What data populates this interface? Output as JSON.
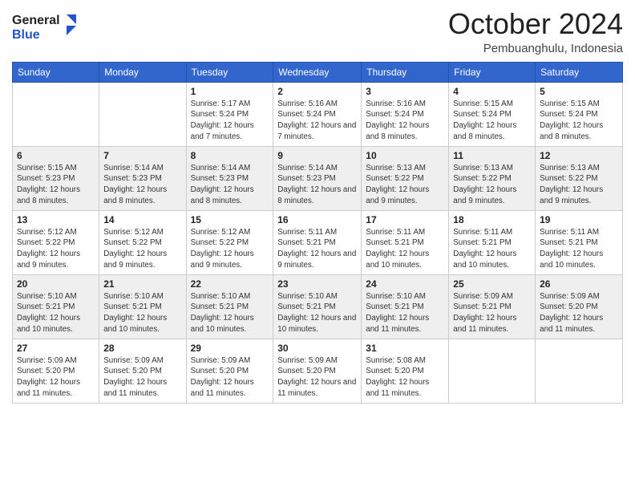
{
  "logo": {
    "line1": "General",
    "line2": "Blue",
    "icon_color": "#2255aa"
  },
  "header": {
    "month": "October 2024",
    "location": "Pembuanghulu, Indonesia"
  },
  "weekdays": [
    "Sunday",
    "Monday",
    "Tuesday",
    "Wednesday",
    "Thursday",
    "Friday",
    "Saturday"
  ],
  "weeks": [
    [
      {
        "day": "",
        "sunrise": "",
        "sunset": "",
        "daylight": ""
      },
      {
        "day": "",
        "sunrise": "",
        "sunset": "",
        "daylight": ""
      },
      {
        "day": "1",
        "sunrise": "Sunrise: 5:17 AM",
        "sunset": "Sunset: 5:24 PM",
        "daylight": "Daylight: 12 hours and 7 minutes."
      },
      {
        "day": "2",
        "sunrise": "Sunrise: 5:16 AM",
        "sunset": "Sunset: 5:24 PM",
        "daylight": "Daylight: 12 hours and 7 minutes."
      },
      {
        "day": "3",
        "sunrise": "Sunrise: 5:16 AM",
        "sunset": "Sunset: 5:24 PM",
        "daylight": "Daylight: 12 hours and 8 minutes."
      },
      {
        "day": "4",
        "sunrise": "Sunrise: 5:15 AM",
        "sunset": "Sunset: 5:24 PM",
        "daylight": "Daylight: 12 hours and 8 minutes."
      },
      {
        "day": "5",
        "sunrise": "Sunrise: 5:15 AM",
        "sunset": "Sunset: 5:24 PM",
        "daylight": "Daylight: 12 hours and 8 minutes."
      }
    ],
    [
      {
        "day": "6",
        "sunrise": "Sunrise: 5:15 AM",
        "sunset": "Sunset: 5:23 PM",
        "daylight": "Daylight: 12 hours and 8 minutes."
      },
      {
        "day": "7",
        "sunrise": "Sunrise: 5:14 AM",
        "sunset": "Sunset: 5:23 PM",
        "daylight": "Daylight: 12 hours and 8 minutes."
      },
      {
        "day": "8",
        "sunrise": "Sunrise: 5:14 AM",
        "sunset": "Sunset: 5:23 PM",
        "daylight": "Daylight: 12 hours and 8 minutes."
      },
      {
        "day": "9",
        "sunrise": "Sunrise: 5:14 AM",
        "sunset": "Sunset: 5:23 PM",
        "daylight": "Daylight: 12 hours and 8 minutes."
      },
      {
        "day": "10",
        "sunrise": "Sunrise: 5:13 AM",
        "sunset": "Sunset: 5:22 PM",
        "daylight": "Daylight: 12 hours and 9 minutes."
      },
      {
        "day": "11",
        "sunrise": "Sunrise: 5:13 AM",
        "sunset": "Sunset: 5:22 PM",
        "daylight": "Daylight: 12 hours and 9 minutes."
      },
      {
        "day": "12",
        "sunrise": "Sunrise: 5:13 AM",
        "sunset": "Sunset: 5:22 PM",
        "daylight": "Daylight: 12 hours and 9 minutes."
      }
    ],
    [
      {
        "day": "13",
        "sunrise": "Sunrise: 5:12 AM",
        "sunset": "Sunset: 5:22 PM",
        "daylight": "Daylight: 12 hours and 9 minutes."
      },
      {
        "day": "14",
        "sunrise": "Sunrise: 5:12 AM",
        "sunset": "Sunset: 5:22 PM",
        "daylight": "Daylight: 12 hours and 9 minutes."
      },
      {
        "day": "15",
        "sunrise": "Sunrise: 5:12 AM",
        "sunset": "Sunset: 5:22 PM",
        "daylight": "Daylight: 12 hours and 9 minutes."
      },
      {
        "day": "16",
        "sunrise": "Sunrise: 5:11 AM",
        "sunset": "Sunset: 5:21 PM",
        "daylight": "Daylight: 12 hours and 9 minutes."
      },
      {
        "day": "17",
        "sunrise": "Sunrise: 5:11 AM",
        "sunset": "Sunset: 5:21 PM",
        "daylight": "Daylight: 12 hours and 10 minutes."
      },
      {
        "day": "18",
        "sunrise": "Sunrise: 5:11 AM",
        "sunset": "Sunset: 5:21 PM",
        "daylight": "Daylight: 12 hours and 10 minutes."
      },
      {
        "day": "19",
        "sunrise": "Sunrise: 5:11 AM",
        "sunset": "Sunset: 5:21 PM",
        "daylight": "Daylight: 12 hours and 10 minutes."
      }
    ],
    [
      {
        "day": "20",
        "sunrise": "Sunrise: 5:10 AM",
        "sunset": "Sunset: 5:21 PM",
        "daylight": "Daylight: 12 hours and 10 minutes."
      },
      {
        "day": "21",
        "sunrise": "Sunrise: 5:10 AM",
        "sunset": "Sunset: 5:21 PM",
        "daylight": "Daylight: 12 hours and 10 minutes."
      },
      {
        "day": "22",
        "sunrise": "Sunrise: 5:10 AM",
        "sunset": "Sunset: 5:21 PM",
        "daylight": "Daylight: 12 hours and 10 minutes."
      },
      {
        "day": "23",
        "sunrise": "Sunrise: 5:10 AM",
        "sunset": "Sunset: 5:21 PM",
        "daylight": "Daylight: 12 hours and 10 minutes."
      },
      {
        "day": "24",
        "sunrise": "Sunrise: 5:10 AM",
        "sunset": "Sunset: 5:21 PM",
        "daylight": "Daylight: 12 hours and 11 minutes."
      },
      {
        "day": "25",
        "sunrise": "Sunrise: 5:09 AM",
        "sunset": "Sunset: 5:21 PM",
        "daylight": "Daylight: 12 hours and 11 minutes."
      },
      {
        "day": "26",
        "sunrise": "Sunrise: 5:09 AM",
        "sunset": "Sunset: 5:20 PM",
        "daylight": "Daylight: 12 hours and 11 minutes."
      }
    ],
    [
      {
        "day": "27",
        "sunrise": "Sunrise: 5:09 AM",
        "sunset": "Sunset: 5:20 PM",
        "daylight": "Daylight: 12 hours and 11 minutes."
      },
      {
        "day": "28",
        "sunrise": "Sunrise: 5:09 AM",
        "sunset": "Sunset: 5:20 PM",
        "daylight": "Daylight: 12 hours and 11 minutes."
      },
      {
        "day": "29",
        "sunrise": "Sunrise: 5:09 AM",
        "sunset": "Sunset: 5:20 PM",
        "daylight": "Daylight: 12 hours and 11 minutes."
      },
      {
        "day": "30",
        "sunrise": "Sunrise: 5:09 AM",
        "sunset": "Sunset: 5:20 PM",
        "daylight": "Daylight: 12 hours and 11 minutes."
      },
      {
        "day": "31",
        "sunrise": "Sunrise: 5:08 AM",
        "sunset": "Sunset: 5:20 PM",
        "daylight": "Daylight: 12 hours and 11 minutes."
      },
      {
        "day": "",
        "sunrise": "",
        "sunset": "",
        "daylight": ""
      },
      {
        "day": "",
        "sunrise": "",
        "sunset": "",
        "daylight": ""
      }
    ]
  ]
}
